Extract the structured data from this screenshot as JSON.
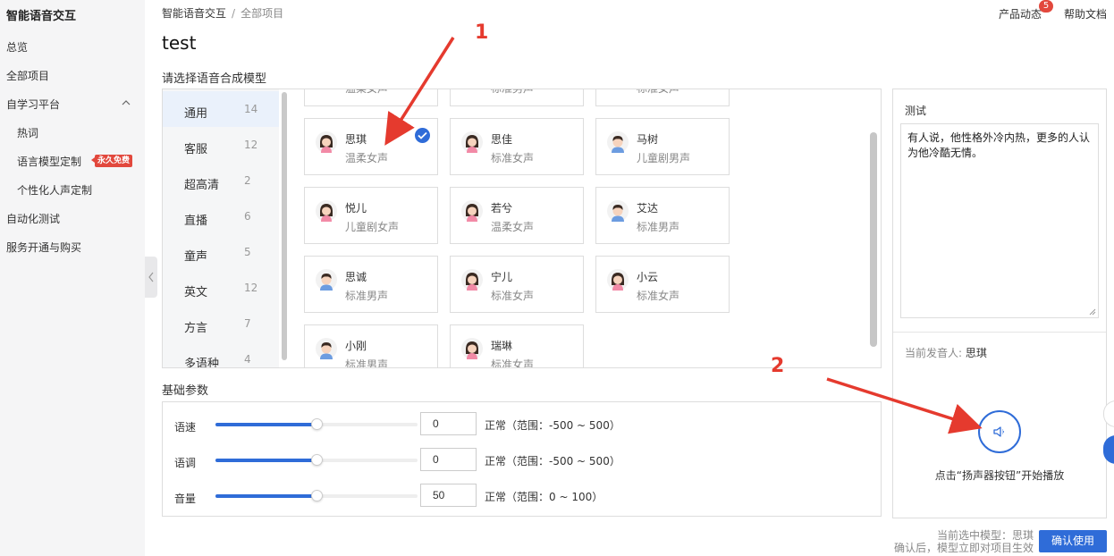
{
  "sidebar": {
    "title": "智能语音交互",
    "items": [
      {
        "label": "总览"
      },
      {
        "label": "全部项目"
      },
      {
        "label": "自学习平台"
      },
      {
        "label": "热词"
      },
      {
        "label": "语言模型定制"
      },
      {
        "label": "个性化人声定制"
      },
      {
        "label": "自动化测试"
      },
      {
        "label": "服务开通与购买"
      }
    ],
    "badge": "永久免费"
  },
  "header": {
    "breadcrumb": [
      "智能语音交互",
      "全部项目"
    ],
    "product_news": "产品动态",
    "product_news_count": "5",
    "help_docs": "帮助文档"
  },
  "page_title": "test",
  "model_section": {
    "label": "请选择语音合成模型",
    "categories": [
      {
        "name": "通用",
        "count": "14"
      },
      {
        "name": "客服",
        "count": "12"
      },
      {
        "name": "超高清",
        "count": "2"
      },
      {
        "name": "直播",
        "count": "6"
      },
      {
        "name": "童声",
        "count": "5"
      },
      {
        "name": "英文",
        "count": "12"
      },
      {
        "name": "方言",
        "count": "7"
      },
      {
        "name": "多语种",
        "count": "4"
      }
    ],
    "partial_cards": [
      {
        "desc": "温柔女声"
      },
      {
        "desc": "标准男声"
      },
      {
        "desc": "标准女声"
      }
    ],
    "voices": [
      {
        "name": "思琪",
        "desc": "温柔女声",
        "gender": "female",
        "selected": true
      },
      {
        "name": "思佳",
        "desc": "标准女声",
        "gender": "female"
      },
      {
        "name": "马树",
        "desc": "儿童剧男声",
        "gender": "male"
      },
      {
        "name": "悦儿",
        "desc": "儿童剧女声",
        "gender": "female"
      },
      {
        "name": "若兮",
        "desc": "温柔女声",
        "gender": "female"
      },
      {
        "name": "艾达",
        "desc": "标准男声",
        "gender": "male"
      },
      {
        "name": "思诚",
        "desc": "标准男声",
        "gender": "male"
      },
      {
        "name": "宁儿",
        "desc": "标准女声",
        "gender": "female"
      },
      {
        "name": "小云",
        "desc": "标准女声",
        "gender": "female"
      },
      {
        "name": "小刚",
        "desc": "标准男声",
        "gender": "male"
      },
      {
        "name": "瑞琳",
        "desc": "标准女声",
        "gender": "female"
      }
    ]
  },
  "params": {
    "label": "基础参数",
    "rows": [
      {
        "label": "语速",
        "value": "0",
        "range": "正常（范围：-500 ~ 500）",
        "fill": 0.5
      },
      {
        "label": "语调",
        "value": "0",
        "range": "正常（范围：-500 ~ 500）",
        "fill": 0.5
      },
      {
        "label": "音量",
        "value": "50",
        "range": "正常（范围：0 ~ 100）",
        "fill": 0.5
      }
    ]
  },
  "test": {
    "title": "测试",
    "text": "有人说，他性格外冷内热，更多的人认为他冷酷无情。",
    "speaker_prefix": "当前发音人: ",
    "speaker": "思琪",
    "play_hint": "点击“扬声器按钮”开始播放"
  },
  "footer": {
    "current_model": "当前选中模型：思琪",
    "note": "确认后，模型立即对项目生效",
    "confirm": "确认使用"
  },
  "annotations": [
    "1",
    "2"
  ],
  "colors": {
    "accent": "#2f6cd8",
    "annotation": "#e53a2e",
    "badge": "#e2483d"
  }
}
